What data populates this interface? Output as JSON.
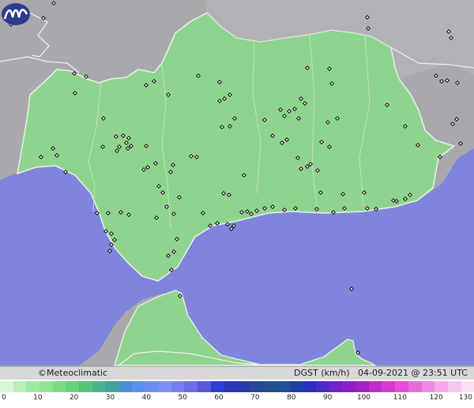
{
  "map": {
    "brand": "©Meteoclimatic",
    "variable": "DGST (km/h)",
    "date": "04-09-2021",
    "time_sep": "@",
    "time": "23:51 UTC"
  },
  "colors": {
    "land_outside": "#a9a9ad",
    "sea": "#7f84dc",
    "region_fill": "#8fd48e",
    "region_border": "#e8efe8",
    "station": "#1a1a1a"
  },
  "legend": {
    "unit": "km/h",
    "ticks": [
      "0",
      "10",
      "20",
      "30",
      "40",
      "50",
      "60",
      "70",
      "80",
      "90",
      "100",
      "110",
      "120",
      "130"
    ],
    "min": 0,
    "max": 130,
    "colors": [
      "#d8f7d8",
      "#b8f0b8",
      "#a2eaa3",
      "#8fe591",
      "#7bdc82",
      "#69d27a",
      "#58c474",
      "#4bb58a",
      "#41a49c",
      "#4b8fd3",
      "#5b8ff0",
      "#6b8ff5",
      "#7f90f4",
      "#7b7fee",
      "#6e6ce6",
      "#5a57da",
      "#2a3fd0",
      "#2c36b8",
      "#283ca6",
      "#244796",
      "#1f4f8c",
      "#1e4f97",
      "#1d3fa8",
      "#2b2fbd",
      "#4b2bc5",
      "#6f22c9",
      "#8f1dc9",
      "#a51fc4",
      "#c12dc6",
      "#d73ad0",
      "#e24fd8",
      "#ea6bde",
      "#f089e4",
      "#f5a8ea",
      "#f9c7f1",
      "#fbe1f7"
    ]
  }
}
